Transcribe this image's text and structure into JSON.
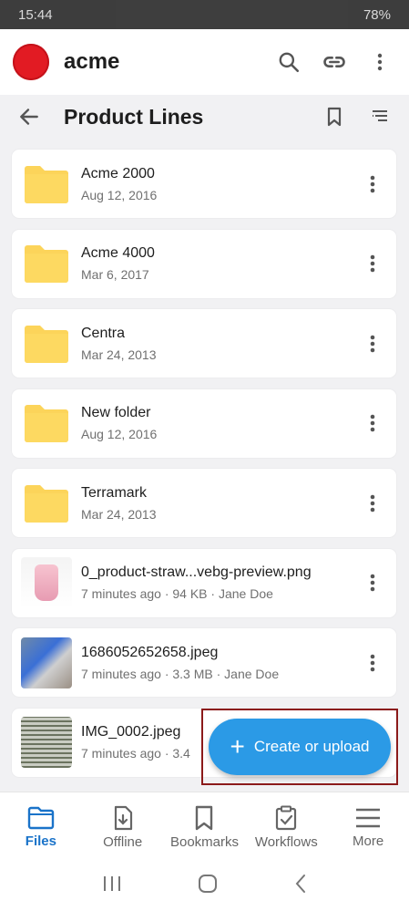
{
  "status_bar": {
    "time": "15:44",
    "battery": "78%"
  },
  "app_bar": {
    "brand": "acme",
    "icons": [
      "search-icon",
      "link-icon",
      "overflow-menu-icon"
    ]
  },
  "title_bar": {
    "title": "Product Lines"
  },
  "items": [
    {
      "name": "Acme 2000",
      "detail": "Aug 12, 2016",
      "type": "folder"
    },
    {
      "name": "Acme 4000",
      "detail": "Mar 6, 2017",
      "type": "folder"
    },
    {
      "name": "Centra",
      "detail": "Mar 24, 2013",
      "type": "folder"
    },
    {
      "name": "New folder",
      "detail": "Aug 12, 2016",
      "type": "folder"
    },
    {
      "name": "Terramark",
      "detail": "Mar 24, 2013",
      "type": "folder"
    },
    {
      "name": "0_product-straw...vebg-preview.png",
      "detail": "7 minutes ago · 94 KB · Jane Doe",
      "type": "image"
    },
    {
      "name": "1686052652658.jpeg",
      "detail": "7 minutes ago · 3.3 MB · Jane Doe",
      "type": "image"
    },
    {
      "name": "IMG_0002.jpeg",
      "detail": "7 minutes ago · 3.4 ",
      "type": "image"
    }
  ],
  "fab": {
    "label": "Create or upload"
  },
  "bottom_nav": [
    {
      "label": "Files",
      "active": true
    },
    {
      "label": "Offline",
      "active": false
    },
    {
      "label": "Bookmarks",
      "active": false
    },
    {
      "label": "Workflows",
      "active": false
    },
    {
      "label": "More",
      "active": false
    }
  ],
  "colors": {
    "accent": "#2b9ae6",
    "active_nav": "#1a73c9",
    "folder": "#fcd45a",
    "logo": "#e21b23"
  }
}
